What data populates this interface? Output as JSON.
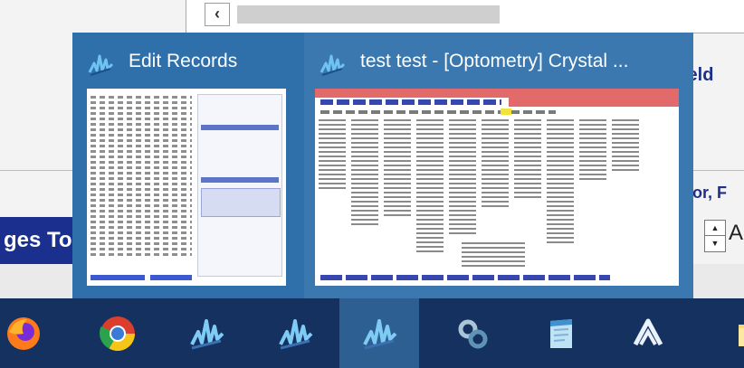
{
  "background": {
    "scroll_left_glyph": "‹",
    "field_label": "ield",
    "color_label": "lor, F",
    "ges_label": "ges To",
    "spinner_up": "▲",
    "spinner_down": "▼",
    "a_label": "A"
  },
  "popup": {
    "thumbnails": [
      {
        "title": "Edit Records",
        "icon": "crystal-app-icon"
      },
      {
        "title": "test  test - [Optometry] Crystal ...",
        "icon": "crystal-app-icon"
      }
    ]
  },
  "taskbar": {
    "items": [
      {
        "name": "firefox-icon"
      },
      {
        "name": "chrome-icon"
      },
      {
        "name": "crystal-app-icon"
      },
      {
        "name": "crystal-app-icon"
      },
      {
        "name": "crystal-app-icon",
        "active": true
      },
      {
        "name": "link-app-icon"
      },
      {
        "name": "notepad-icon"
      },
      {
        "name": "atlassian-icon"
      },
      {
        "name": "folder-icon"
      }
    ]
  },
  "colors": {
    "popup_bg": "#2f70aa",
    "taskbar_bg": "#14315f",
    "active_item": "#2e5f92",
    "label_blue": "#1d2f8a"
  }
}
